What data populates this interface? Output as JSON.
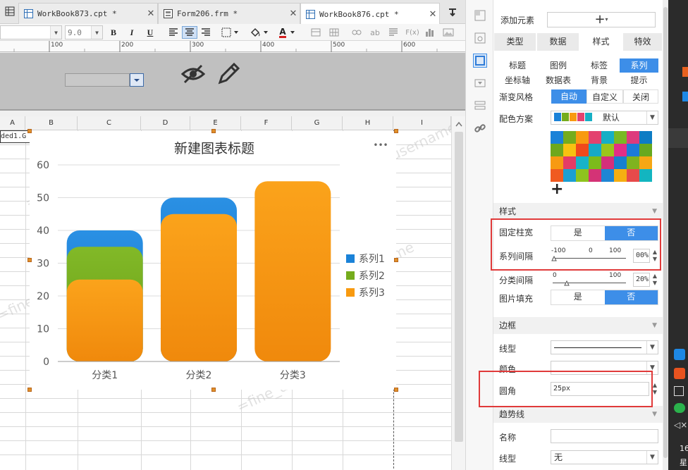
{
  "tabs": [
    {
      "label": "WorkBook873.cpt *",
      "active": false
    },
    {
      "label": "Form206.frm *",
      "active": false
    },
    {
      "label": "WorkBook876.cpt *",
      "active": true
    }
  ],
  "toolbar": {
    "font_size": "9.0",
    "bold": "B",
    "italic": "I",
    "underline": "U",
    "font_color_glyph": "A",
    "text_ab": "ab",
    "fx": "F(x)"
  },
  "ruler": {
    "marks": [
      "100",
      "200",
      "300",
      "400",
      "500",
      "600"
    ]
  },
  "grid": {
    "columns": [
      "A",
      "B",
      "C",
      "D",
      "E",
      "F",
      "G",
      "H",
      "I"
    ],
    "a1_text": "ded1.G"
  },
  "chart_data": {
    "type": "bar",
    "title": "新建图表标题",
    "menu_glyph": "•••",
    "categories": [
      "分类1",
      "分类2",
      "分类3"
    ],
    "series": [
      {
        "name": "系列1",
        "values": [
          40,
          50,
          0
        ],
        "color": "#1a82d8"
      },
      {
        "name": "系列2",
        "values": [
          35,
          0,
          0
        ],
        "color": "#75ac1c"
      },
      {
        "name": "系列3",
        "values": [
          25,
          45,
          55
        ],
        "color": "#f89a10"
      }
    ],
    "yticks": [
      "0",
      "10",
      "20",
      "30",
      "40",
      "50",
      "60"
    ],
    "ylim": [
      0,
      60
    ],
    "legend_position": "right",
    "grid": true
  },
  "panel": {
    "add_element": "添加元素",
    "add_glyph": "+",
    "main_tabs": [
      {
        "label": "类型",
        "selected": false
      },
      {
        "label": "数据",
        "selected": false
      },
      {
        "label": "样式",
        "selected": true
      },
      {
        "label": "特效",
        "selected": false
      }
    ],
    "sub_tabs_row1": [
      {
        "label": "标题",
        "selected": false
      },
      {
        "label": "图例",
        "selected": false
      },
      {
        "label": "标签",
        "selected": false
      },
      {
        "label": "系列",
        "selected": true
      }
    ],
    "sub_tabs_row2": [
      {
        "label": "坐标轴",
        "selected": false
      },
      {
        "label": "数据表",
        "selected": false
      },
      {
        "label": "背景",
        "selected": false
      },
      {
        "label": "提示",
        "selected": false
      }
    ],
    "gradient_label": "渐变风格",
    "gradient_options": [
      {
        "label": "自动",
        "selected": true
      },
      {
        "label": "自定义",
        "selected": false
      },
      {
        "label": "关闭",
        "selected": false
      }
    ],
    "color_scheme_label": "配色方案",
    "color_scheme_value": "默认",
    "palette_add_glyph": "+",
    "palette_colors": [
      "#1a82d8",
      "#75ac1c",
      "#f89a10",
      "#e3426f",
      "#16afc5",
      "#79b923",
      "#dd3a7d",
      "#0d7cc4",
      "#6ea81d",
      "#f8c110",
      "#f0491c",
      "#16a9c7",
      "#9bc51b",
      "#e22e86",
      "#1c7ad9",
      "#67a91f",
      "#f79a12",
      "#e43c66",
      "#17b3c9",
      "#7cbb1b",
      "#d52f7b",
      "#1680cf",
      "#7fb31f",
      "#f6a715",
      "#f05a20",
      "#1b9fd2",
      "#8ec41e",
      "#d43376",
      "#1e86d4",
      "#f5ae12",
      "#e74a4a",
      "#13b5c0"
    ],
    "style_section": "样式",
    "fixed_width_label": "固定柱宽",
    "fixed_width_options": [
      {
        "label": "是",
        "selected": false
      },
      {
        "label": "否",
        "selected": true
      }
    ],
    "series_gap_label": "系列间隔",
    "series_gap_ticks": [
      "-100",
      "0",
      "100"
    ],
    "series_gap_value": "00%",
    "category_gap_label": "分类间隔",
    "category_gap_ticks": [
      "0",
      "100"
    ],
    "category_gap_value": "20%",
    "image_fill_label": "图片填充",
    "image_fill_options": [
      {
        "label": "是",
        "selected": false
      },
      {
        "label": "否",
        "selected": true
      }
    ],
    "border_section": "边框",
    "line_type_label": "线型",
    "color_label": "颜色",
    "corner_label": "圆角",
    "corner_value": "25px",
    "trend_section": "趋势线",
    "trend_name_label": "名称",
    "trend_name_value": "",
    "trend_line_label": "线型",
    "trend_line_value": "无"
  },
  "watermark": "=fine_username",
  "taskbar": {
    "time_fragment": "16",
    "day_fragment": "星"
  }
}
